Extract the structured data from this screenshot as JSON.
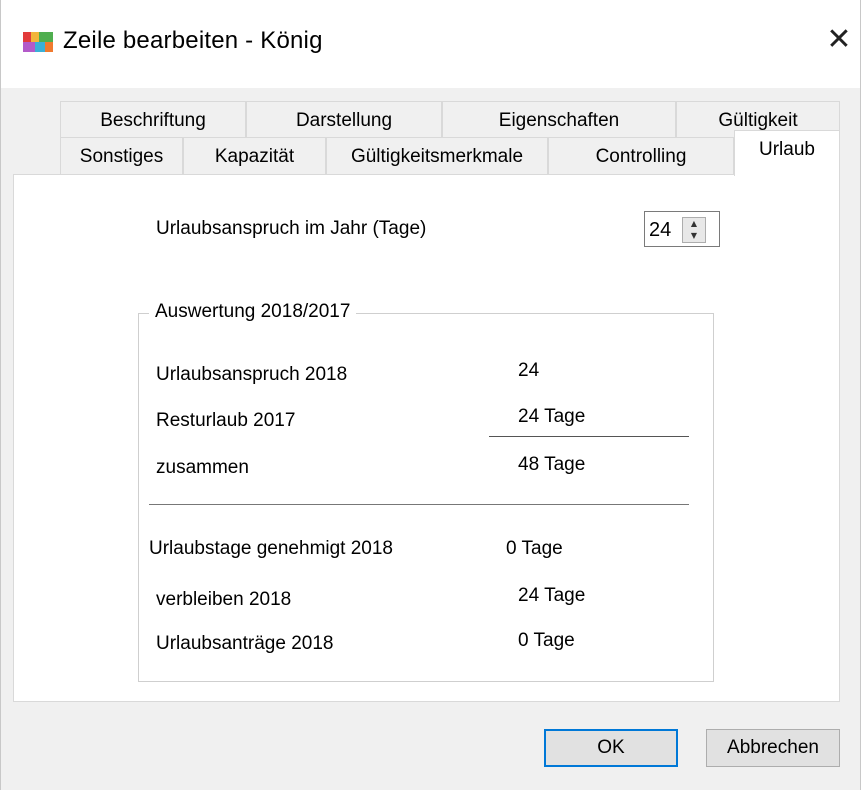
{
  "window": {
    "title": "Zeile  bearbeiten - König",
    "close_symbol": "✕"
  },
  "tabs": {
    "row1": [
      "Beschriftung",
      "Darstellung",
      "Eigenschaften",
      "Gültigkeit"
    ],
    "row2": [
      "Sonstiges",
      "Kapazität",
      "Gültigkeitsmerkmale",
      "Controlling",
      "Urlaub"
    ],
    "active": "Urlaub"
  },
  "urlaub": {
    "anspruch_label": "Urlaubsanspruch im Jahr (Tage)",
    "anspruch_value": "24",
    "group_title": "Auswertung 2018/2017",
    "rows": [
      {
        "label": "Urlaubsanspruch 2018",
        "value": "24"
      },
      {
        "label": "Resturlaub 2017",
        "value": "24 Tage"
      },
      {
        "label": "zusammen",
        "value": "48 Tage"
      },
      {
        "label": "Urlaubstage genehmigt 2018",
        "value": "0 Tage"
      },
      {
        "label": "verbleiben 2018",
        "value": "24 Tage"
      },
      {
        "label": "Urlaubsanträge 2018",
        "value": "0 Tage"
      }
    ]
  },
  "buttons": {
    "ok": "OK",
    "cancel": "Abbrechen"
  },
  "colors": {
    "dialog_bg": "#f0f0f0",
    "panel_bg": "#ffffff",
    "default_button_border": "#0078d7"
  },
  "icons": {
    "app": "app-icon",
    "close": "close-icon",
    "spin_up": "spin-up-icon",
    "spin_down": "spin-down-icon"
  }
}
